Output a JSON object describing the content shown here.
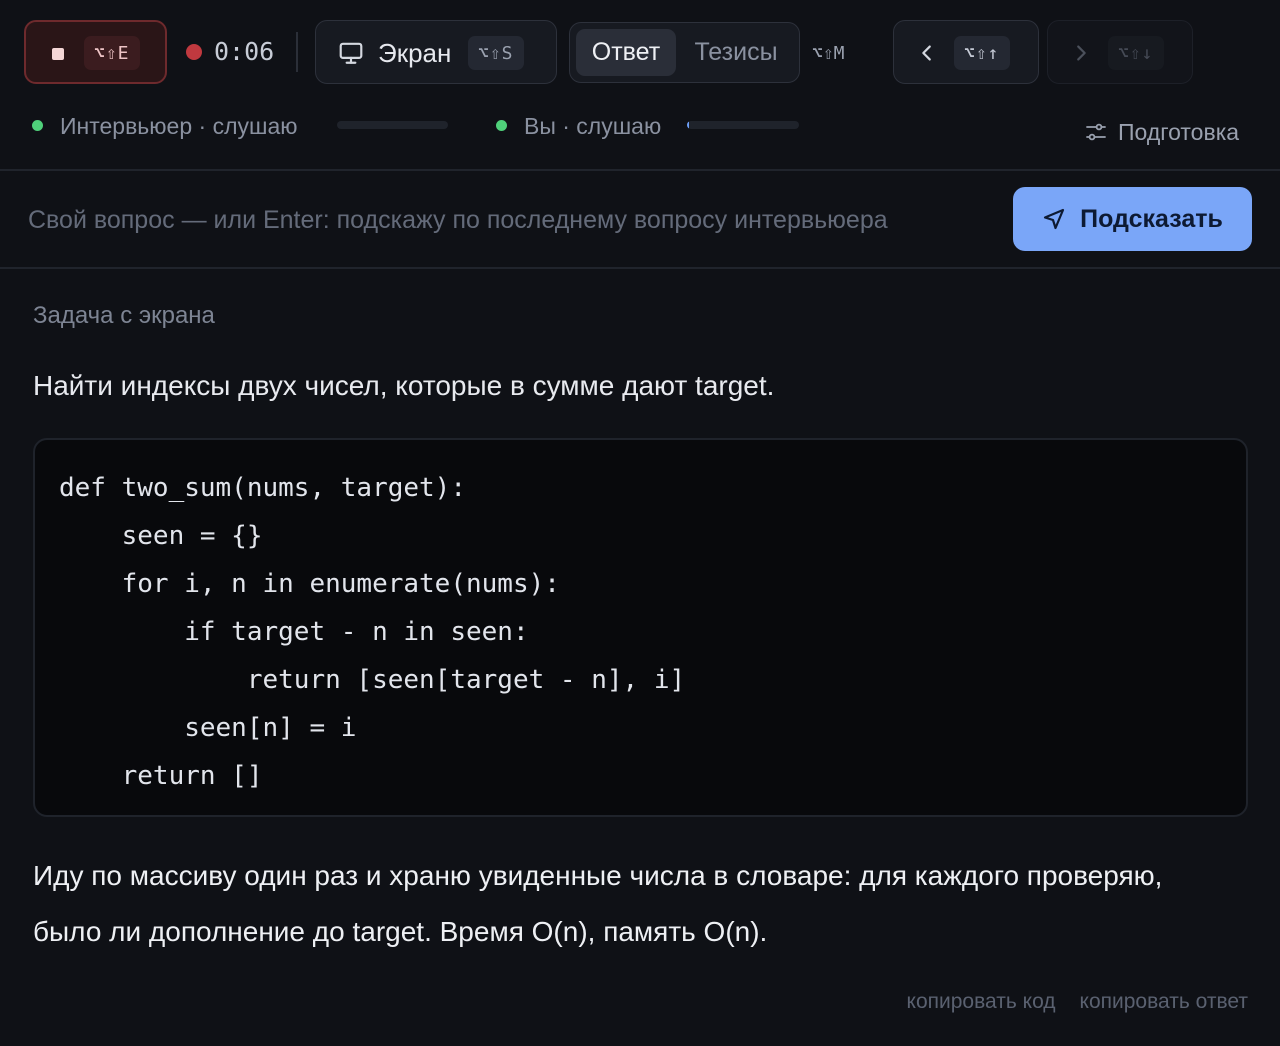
{
  "toolbar": {
    "stop_shortcut": "⌥⇧E",
    "timer": "0:06",
    "screen_label": "Экран",
    "screen_shortcut": "⌥⇧S",
    "mode_tabs": [
      {
        "label": "Ответ",
        "active": true
      },
      {
        "label": "Тезисы",
        "active": false
      }
    ],
    "mode_shortcut": "⌥⇧M",
    "prev_shortcut": "⌥⇧↑",
    "next_shortcut": "⌥⇧↓"
  },
  "listening": {
    "interviewer_label": "Интервьюер · слушаю",
    "interviewer_level": 0.0,
    "you_label": "Вы · слушаю",
    "you_level": 0.02,
    "status_color": "#4fd07a"
  },
  "prep": {
    "label": "Подготовка"
  },
  "ask": {
    "placeholder": "Свой вопрос — или Enter: подскажу по последнему вопросу интервьюера",
    "value": "",
    "submit_label": "Подсказать",
    "accent_color": "#7aa6f8"
  },
  "content": {
    "section_label": "Задача с экрана",
    "task": "Найти индексы двух чисел, которые в сумме дают target.",
    "code_lines": [
      "def two_sum(nums, target):",
      "    seen = {}",
      "    for i, n in enumerate(nums):",
      "        if target - n in seen:",
      "            return [seen[target - n], i]",
      "        seen[n] = i",
      "    return []"
    ],
    "answer": "Иду по массиву один раз и храню увиденные числа в словаре: для каждого проверяю, было ли дополнение до target. Время O(n), память O(n)."
  },
  "footer": {
    "copy_code": "копировать код",
    "copy_answer": "копировать ответ"
  }
}
